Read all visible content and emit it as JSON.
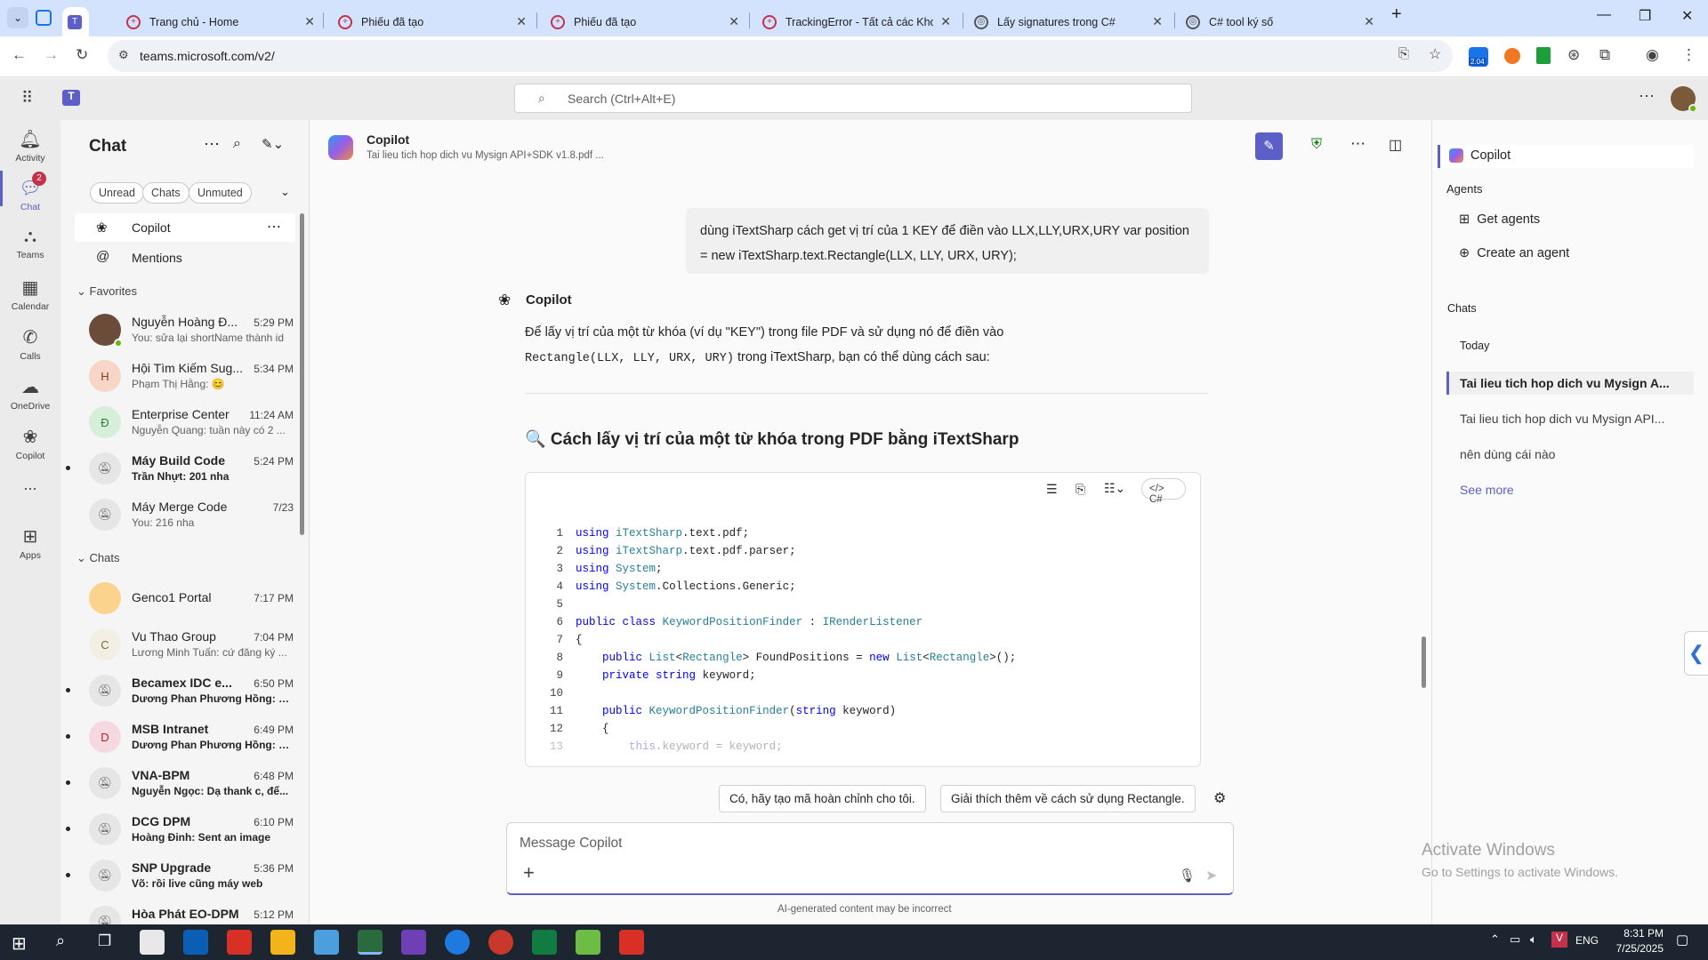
{
  "browser": {
    "tabs": [
      {
        "label": "Trang chủ - Home"
      },
      {
        "label": "Phiếu đã tạo"
      },
      {
        "label": "Phiếu đã tạo"
      },
      {
        "label": "TrackingError - Tất cả các Khoản"
      },
      {
        "label": "Lấy signatures trong C#"
      },
      {
        "label": "C# tool ký số"
      }
    ],
    "url": "teams.microsoft.com/v2/",
    "ext_badge": "2.04"
  },
  "teams": {
    "search_placeholder": "Search (Ctrl+Alt+E)",
    "rail": [
      {
        "label": "Activity"
      },
      {
        "label": "Chat",
        "badge": "2"
      },
      {
        "label": "Teams"
      },
      {
        "label": "Calendar"
      },
      {
        "label": "Calls"
      },
      {
        "label": "OneDrive"
      },
      {
        "label": "Copilot"
      },
      {
        "label": "..."
      },
      {
        "label": "Apps"
      }
    ],
    "chatlist": {
      "title": "Chat",
      "filters": [
        "Unread",
        "Chats",
        "Unmuted"
      ],
      "pinned": [
        {
          "label": "Copilot"
        },
        {
          "label": "Mentions"
        }
      ],
      "favorites_header": "Favorites",
      "chats_header": "Chats",
      "favorites": [
        {
          "name": "Nguyễn Hoàng Đ...",
          "time": "5:29 PM",
          "preview": "You:  sửa lại shortName thành id",
          "initial": ""
        },
        {
          "name": "Hội Tìm Kiếm Sug...",
          "time": "5:34 PM",
          "preview": "Phạm Thị Hằng: 😊",
          "initial": "H"
        },
        {
          "name": "Enterprise Center",
          "time": "11:24 AM",
          "preview": "Nguyễn Quang: tuần này có 2 ...",
          "initial": "Đ"
        },
        {
          "name": "Máy Build Code",
          "time": "5:24 PM",
          "preview": "Trần Nhựt: 201 nha",
          "initial": ""
        },
        {
          "name": "Máy Merge Code",
          "time": "7/23",
          "preview": "You: 216  nha",
          "initial": ""
        }
      ],
      "chats": [
        {
          "name": "Genco1 Portal",
          "time": "7:17 PM",
          "preview": "",
          "initial": ""
        },
        {
          "name": "Vu Thao Group",
          "time": "7:04 PM",
          "preview": "Lương Minh Tuấn: cứ đăng ký ...",
          "initial": "C"
        },
        {
          "name": "Becamex IDC e...",
          "time": "6:50 PM",
          "preview": "Dương Phan Phương Hồng: e...",
          "initial": ""
        },
        {
          "name": "MSB Intranet",
          "time": "6:49 PM",
          "preview": "Dương Phan Phương Hồng: S...",
          "initial": "D"
        },
        {
          "name": "VNA-BPM",
          "time": "6:48 PM",
          "preview": "Nguyễn Ngọc: Dạ thank c, để...",
          "initial": ""
        },
        {
          "name": "DCG DPM",
          "time": "6:10 PM",
          "preview": "Hoàng Đinh: Sent an image",
          "initial": ""
        },
        {
          "name": "SNP Upgrade",
          "time": "5:36 PM",
          "preview": "Võ: rồi live cũng máy web",
          "initial": ""
        },
        {
          "name": "Hòa Phát EO-DPM",
          "time": "5:12 PM",
          "preview": "",
          "initial": ""
        }
      ]
    },
    "conversation": {
      "title": "Copilot",
      "subtitle": "Tai lieu tich hop dich vu Mysign API+SDK v1.8.pdf ...",
      "user_message": "dùng iTextSharp cách get vị trí của 1 KEY để điền vào LLX,LLY,URX,URY var position = new iTextSharp.text.Rectangle(LLX, LLY, URX, URY);",
      "bot_name": "Copilot",
      "bot_intro_1": "Để lấy vị trí của một từ khóa (ví dụ \"KEY\") trong file PDF và sử dụng nó để điền vào ",
      "bot_intro_code": "Rectangle(LLX, LLY, URX, URY)",
      "bot_intro_2": " trong iTextSharp, bạn có thể dùng cách sau:",
      "heading": "🔍 Cách lấy vị trí của một từ khóa trong PDF bằng iTextSharp",
      "code_lang": "C#",
      "code_lines": [
        "using iTextSharp.text.pdf;",
        "using iTextSharp.text.pdf.parser;",
        "using System;",
        "using System.Collections.Generic;",
        "",
        "public class KeywordPositionFinder : IRenderListener",
        "{",
        "    public List<Rectangle> FoundPositions = new List<Rectangle>();",
        "    private string keyword;",
        "",
        "    public KeywordPositionFinder(string keyword)",
        "    {",
        "        this.keyword = keyword;"
      ],
      "suggestions": [
        "Có, hãy tạo mã hoàn chỉnh cho tôi.",
        "Giải thích thêm về cách sử dụng Rectangle."
      ],
      "input_placeholder": "Message Copilot",
      "disclaimer": "AI-generated content may be incorrect"
    },
    "rightpane": {
      "title": "Copilot",
      "agents_header": "Agents",
      "agents": [
        "Get agents",
        "Create an agent"
      ],
      "chats_header": "Chats",
      "today": "Today",
      "history": [
        "Tai lieu tich hop dich vu Mysign A...",
        "Tai lieu tich hop dich vu Mysign API...",
        "nên dùng cái nào"
      ],
      "see_more": "See more"
    }
  },
  "watermark": {
    "line1": "Activate Windows",
    "line2": "Go to Settings to activate Windows."
  },
  "taskbar": {
    "time": "8:31 PM",
    "date": "7/25/2025",
    "lang": "ENG"
  }
}
